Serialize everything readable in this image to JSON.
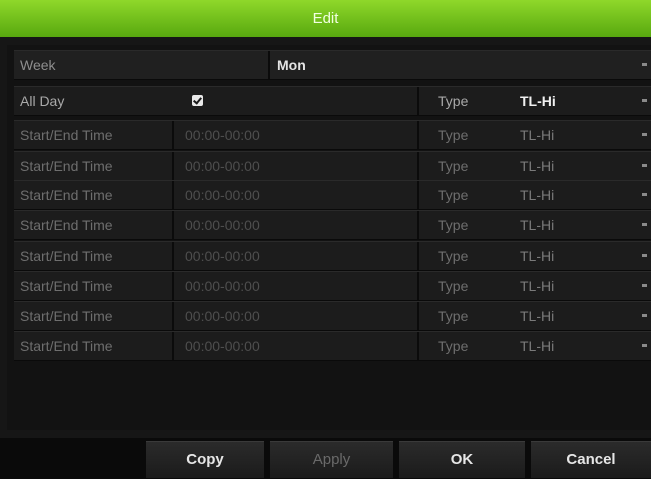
{
  "dialog": {
    "title": "Edit"
  },
  "week": {
    "label": "Week",
    "value": "Mon"
  },
  "all_day": {
    "label": "All Day",
    "checked": true,
    "type_label": "Type",
    "type_value": "TL-Hi"
  },
  "periods": [
    {
      "label": "Start/End Time",
      "time": "00:00-00:00",
      "type_label": "Type",
      "type_value": "TL-Hi"
    },
    {
      "label": "Start/End Time",
      "time": "00:00-00:00",
      "type_label": "Type",
      "type_value": "TL-Hi"
    },
    {
      "label": "Start/End Time",
      "time": "00:00-00:00",
      "type_label": "Type",
      "type_value": "TL-Hi"
    },
    {
      "label": "Start/End Time",
      "time": "00:00-00:00",
      "type_label": "Type",
      "type_value": "TL-Hi"
    },
    {
      "label": "Start/End Time",
      "time": "00:00-00:00",
      "type_label": "Type",
      "type_value": "TL-Hi"
    },
    {
      "label": "Start/End Time",
      "time": "00:00-00:00",
      "type_label": "Type",
      "type_value": "TL-Hi"
    },
    {
      "label": "Start/End Time",
      "time": "00:00-00:00",
      "type_label": "Type",
      "type_value": "TL-Hi"
    },
    {
      "label": "Start/End Time",
      "time": "00:00-00:00",
      "type_label": "Type",
      "type_value": "TL-Hi"
    }
  ],
  "buttons": {
    "copy": "Copy",
    "apply": "Apply",
    "ok": "OK",
    "cancel": "Cancel"
  },
  "colors": {
    "title_bar": "#6cc11a",
    "background": "#161616",
    "row": "#1c1c1c"
  },
  "icons": {
    "checkbox": "checkbox-checked-icon",
    "dropdown": "dropdown-arrow-icon"
  }
}
